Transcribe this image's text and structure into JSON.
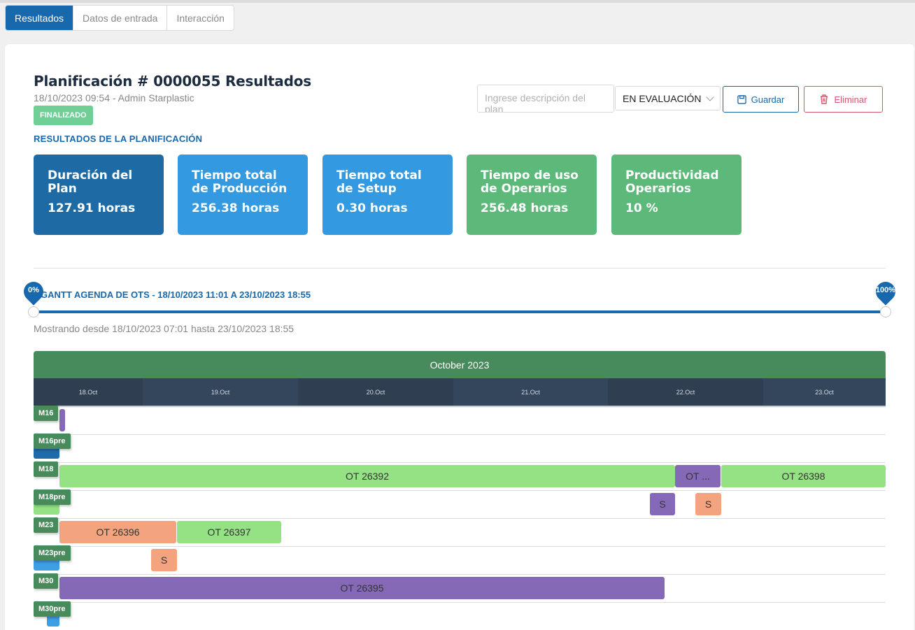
{
  "tabs": [
    "Resultados",
    "Datos de entrada",
    "Interacción"
  ],
  "header": {
    "title": "Planificación # 0000055 Resultados",
    "subtitle": "18/10/2023 09:54 - Admin Starplastic",
    "status_badge": "FINALIZADO",
    "section_label": "RESULTADOS DE LA PLANIFICACIÓN"
  },
  "actions": {
    "description_placeholder": "Ingrese descripción del plan",
    "status_value": "EN EVALUACIÓN",
    "save_label": "Guardar",
    "delete_label": "Eliminar"
  },
  "kpis": [
    {
      "label": "Duración del Plan",
      "value": "127.91 horas",
      "color": "#1d6aa5"
    },
    {
      "label": "Tiempo total de Producción",
      "value": "256.38 horas",
      "color": "#3399e0"
    },
    {
      "label": "Tiempo total de Setup",
      "value": "0.30 horas",
      "color": "#3399e0"
    },
    {
      "label": "Tiempo de uso de Operarios",
      "value": "256.48 horas",
      "color": "#5db97a"
    },
    {
      "label": "Productividad Operarios",
      "value": "10 %",
      "color": "#5db97a"
    }
  ],
  "gantt": {
    "title": "GANTT AGENDA DE OTS - 18/10/2023 11:01 A 23/10/2023 18:55",
    "range_min_label": "0%",
    "range_max_label": "100%",
    "range_min": 0,
    "range_max": 1,
    "showing_note": "Mostrando desde 18/10/2023 07:01 hasta 23/10/2023 18:55",
    "month": "October 2023",
    "days": [
      "18.Oct",
      "19.Oct",
      "20.Oct",
      "21.Oct",
      "22.Oct",
      "23.Oct"
    ],
    "machines": [
      "M16",
      "M16pre",
      "M18",
      "M18pre",
      "M23",
      "M23pre",
      "M30",
      "M30pre"
    ],
    "bars": [
      {
        "machine": "M18",
        "label": "OT 26392",
        "color": "#95e284"
      },
      {
        "machine": "M18",
        "label": "OT ...",
        "color": "#8669b6"
      },
      {
        "machine": "M18",
        "label": "OT 26398",
        "color": "#95e284"
      },
      {
        "machine": "M18pre",
        "label": "S",
        "color": "#8669b6"
      },
      {
        "machine": "M18pre",
        "label": "S",
        "color": "#f3a47f"
      },
      {
        "machine": "M23",
        "label": "OT 26396",
        "color": "#f3a47f"
      },
      {
        "machine": "M23",
        "label": "OT 26397",
        "color": "#95e284"
      },
      {
        "machine": "M23pre",
        "label": "S",
        "color": "#f3a47f"
      },
      {
        "machine": "M30",
        "label": "OT 26395",
        "color": "#8669b6"
      }
    ]
  }
}
